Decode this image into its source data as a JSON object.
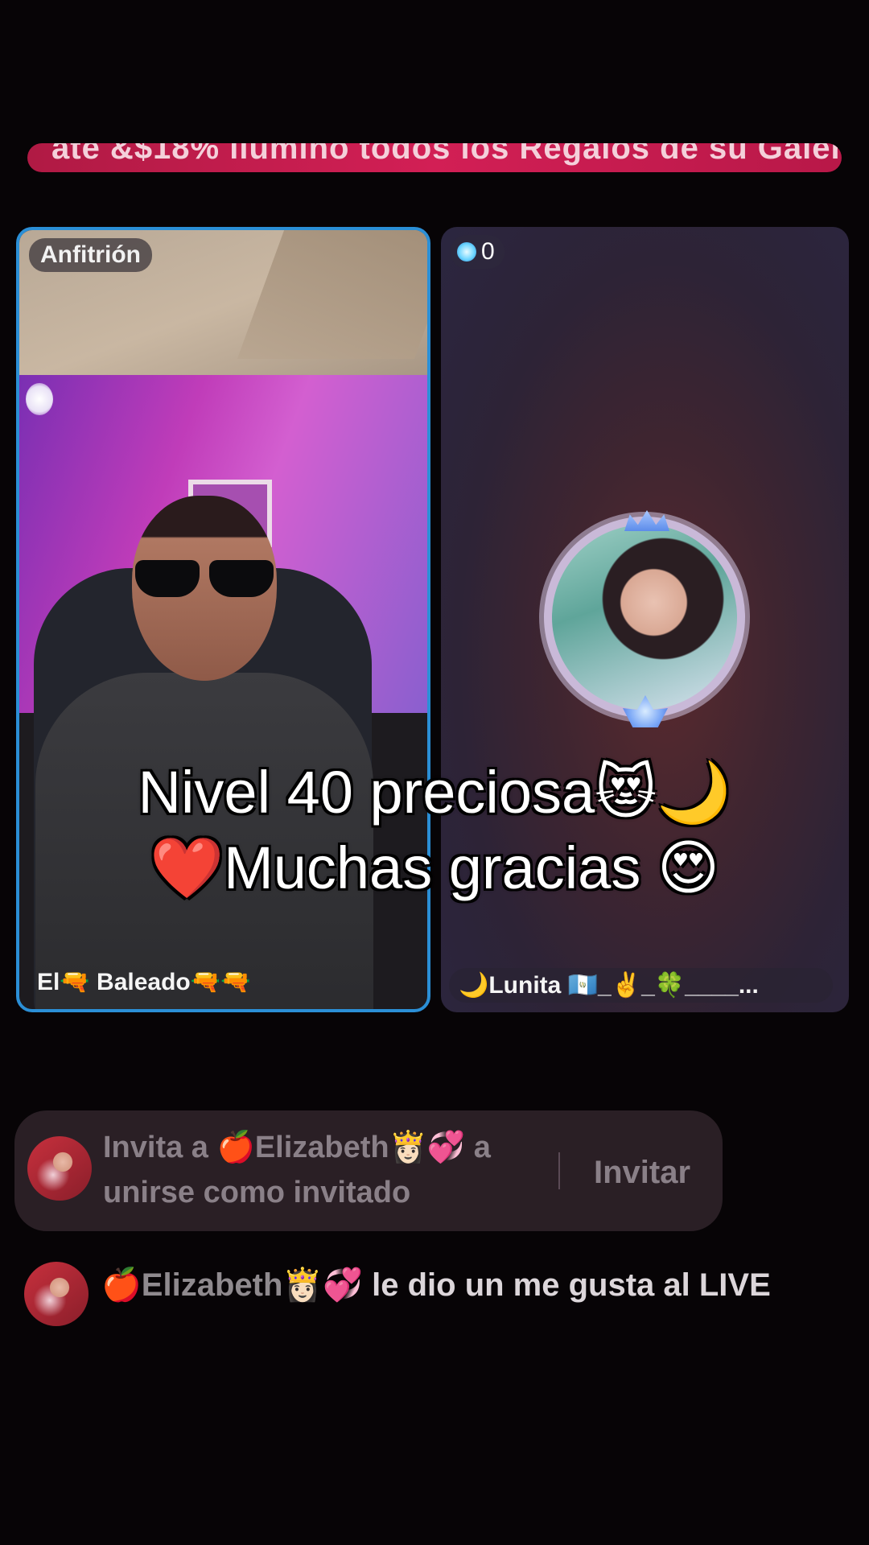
{
  "banner": {
    "text": "ate  &$18%  llumino todos los Regalos de su Galer"
  },
  "host": {
    "badge": "Anfitrión",
    "name": "El🔫 Baleado🔫🔫"
  },
  "guest": {
    "score": "0",
    "name": "🌙Lunita 🇬🇹_✌️_🍀____..."
  },
  "caption": {
    "line1": "Nivel 40 preciosa😻🌙",
    "line2": "❤️Muchas gracias 😍"
  },
  "invite_notice": {
    "text": "Invita a 🍎Elizabeth👸🏻💞 a unirse como invitado",
    "button_label": "Invitar"
  },
  "comment": {
    "user": "🍎Elizabeth👸🏻💞",
    "message": "le dio un me gusta al LIVE"
  },
  "colors": {
    "host_border": "#2b8fd6",
    "banner": "#d21f55"
  }
}
